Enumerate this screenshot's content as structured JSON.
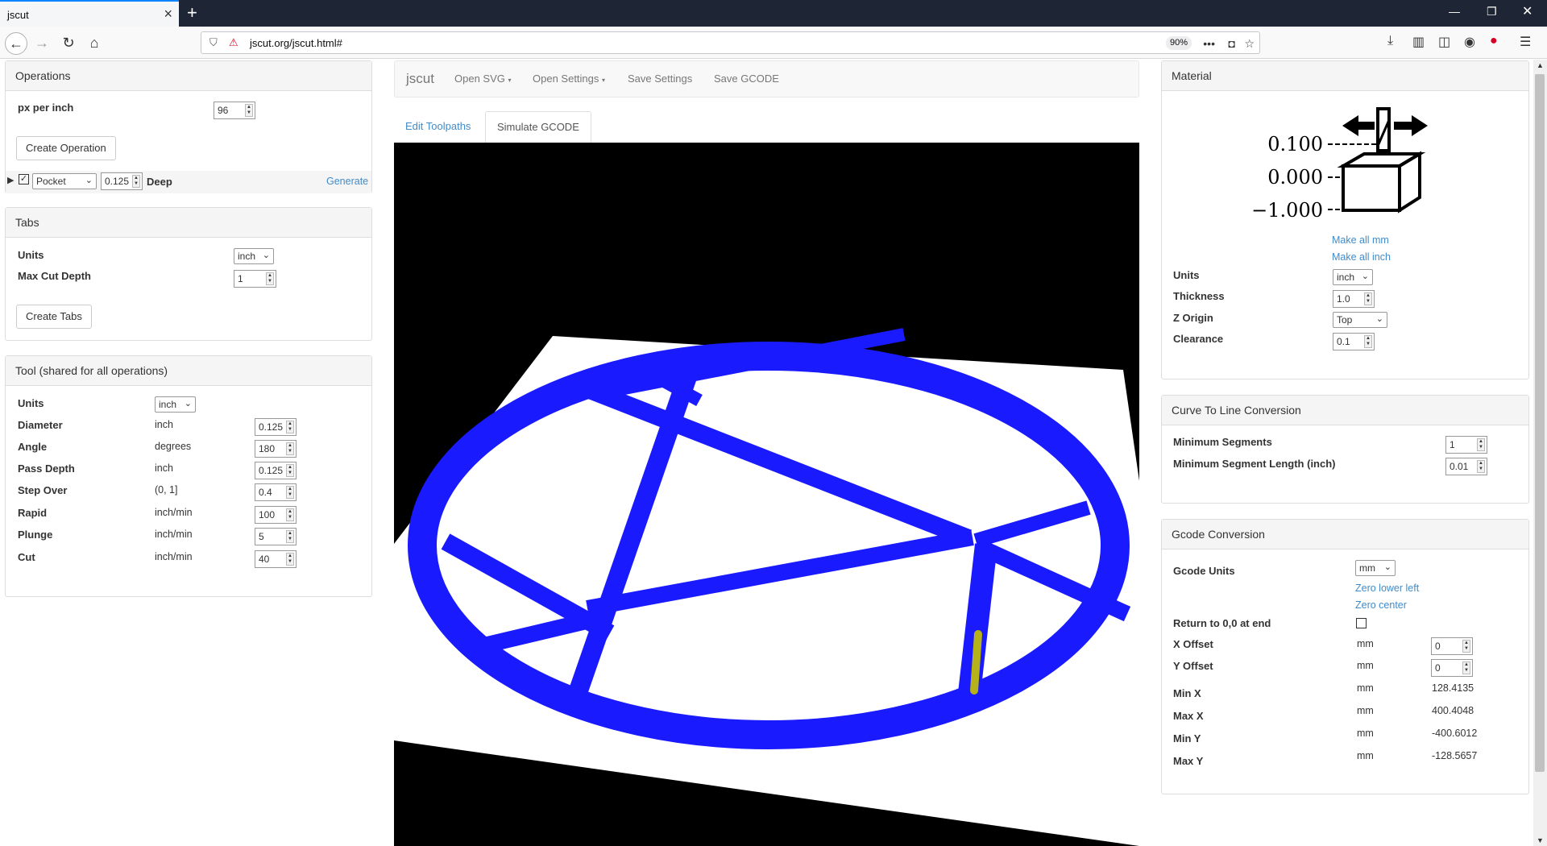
{
  "browser": {
    "tab_title": "jscut",
    "url": "jscut.org/jscut.html#",
    "zoom": "90%"
  },
  "app": {
    "brand": "jscut",
    "menu": [
      "Open SVG",
      "Open Settings",
      "Save Settings",
      "Save GCODE"
    ],
    "view_tabs": [
      "Edit Toolpaths",
      "Simulate GCODE"
    ],
    "active_view_tab": "Simulate GCODE"
  },
  "operations": {
    "title": "Operations",
    "px_per_inch_label": "px per inch",
    "px_per_inch": "96",
    "create_label": "Create Operation",
    "row": {
      "type": "Pocket",
      "depth": "0.125",
      "depth_label": "Deep",
      "generate_label": "Generate",
      "enabled": true
    }
  },
  "tabs": {
    "title": "Tabs",
    "units_label": "Units",
    "units": "inch",
    "max_cut_depth_label": "Max Cut Depth",
    "max_cut_depth": "1",
    "create_label": "Create Tabs"
  },
  "tool": {
    "title": "Tool (shared for all operations)",
    "units_label": "Units",
    "units": "inch",
    "rows": [
      {
        "label": "Diameter",
        "unit": "inch",
        "value": "0.125"
      },
      {
        "label": "Angle",
        "unit": "degrees",
        "value": "180"
      },
      {
        "label": "Pass Depth",
        "unit": "inch",
        "value": "0.125"
      },
      {
        "label": "Step Over",
        "unit": "(0, 1]",
        "value": "0.4"
      },
      {
        "label": "Rapid",
        "unit": "inch/min",
        "value": "100"
      },
      {
        "label": "Plunge",
        "unit": "inch/min",
        "value": "5"
      },
      {
        "label": "Cut",
        "unit": "inch/min",
        "value": "40"
      }
    ]
  },
  "material": {
    "title": "Material",
    "diagram_values": [
      "0.100",
      "0.000",
      "−1.000"
    ],
    "make_all_mm": "Make all mm",
    "make_all_inch": "Make all inch",
    "units_label": "Units",
    "units": "inch",
    "thickness_label": "Thickness",
    "thickness": "1.0",
    "z_origin_label": "Z Origin",
    "z_origin": "Top",
    "clearance_label": "Clearance",
    "clearance": "0.1"
  },
  "curve": {
    "title": "Curve To Line Conversion",
    "min_segments_label": "Minimum Segments",
    "min_segments": "1",
    "min_seg_len_label": "Minimum Segment Length (inch)",
    "min_seg_len": "0.01"
  },
  "gcode": {
    "title": "Gcode Conversion",
    "units_label": "Gcode Units",
    "units": "mm",
    "zero_lower_left": "Zero lower left",
    "zero_center": "Zero center",
    "return_label": "Return to 0,0 at end",
    "return_checked": false,
    "x_offset_label": "X Offset",
    "x_offset": "0",
    "y_offset_label": "Y Offset",
    "y_offset": "0",
    "unit_text": "mm",
    "min_x_label": "Min X",
    "min_x": "128.4135",
    "max_x_label": "Max X",
    "max_x": "400.4048",
    "min_y_label": "Min Y",
    "min_y": "-400.6012",
    "max_y_label": "Max Y",
    "max_y": "-128.5657"
  },
  "colors": {
    "toolpath": "#1a1aff",
    "tool": "#b5b21a",
    "link": "#428bca"
  }
}
